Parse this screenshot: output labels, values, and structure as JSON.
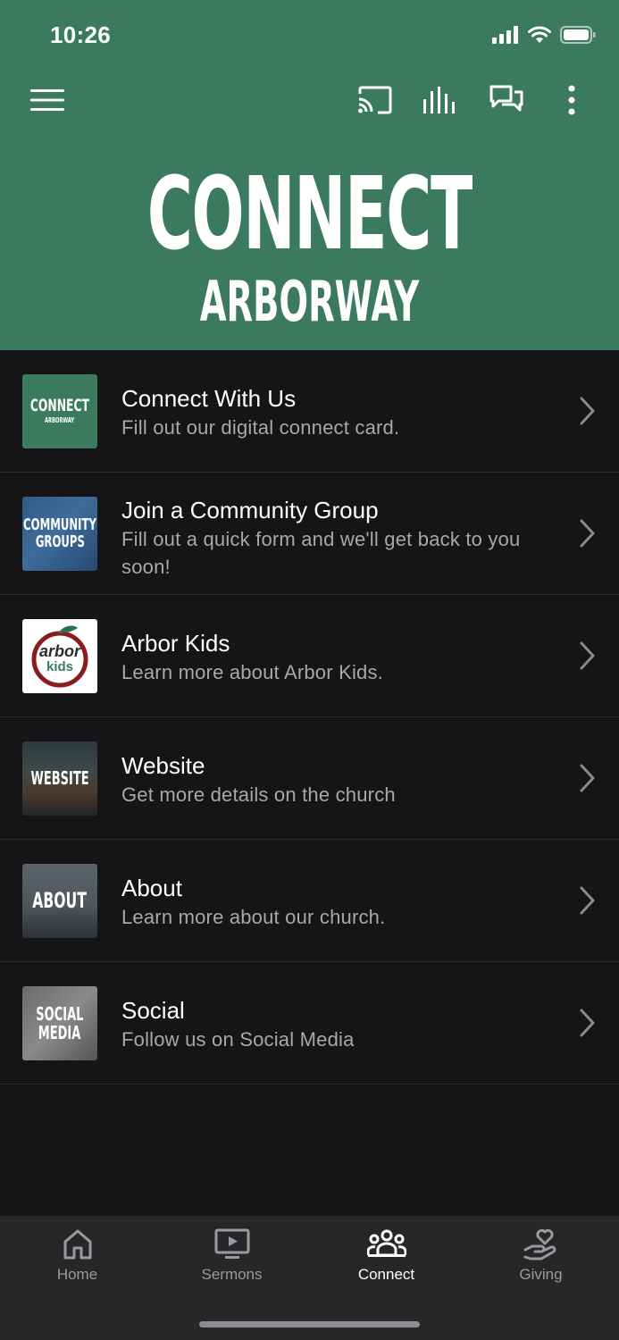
{
  "status": {
    "time": "10:26"
  },
  "hero": {
    "title": "CONNECT",
    "subtitle": "ARBORWAY"
  },
  "items": [
    {
      "thumb_line1": "CONNECT",
      "thumb_line2": "ARBORWAY",
      "title": "Connect With Us",
      "subtitle": "Fill out our digital connect card."
    },
    {
      "thumb_line1": "COMMUNITY",
      "thumb_line2": "GROUPS",
      "title": "Join a Community Group",
      "subtitle": "Fill out a quick form and we'll get back to you soon!"
    },
    {
      "thumb_line1": "arbor",
      "thumb_line2": "kids",
      "title": "Arbor Kids",
      "subtitle": "Learn more about Arbor Kids."
    },
    {
      "thumb_line1": "WEBSITE",
      "thumb_line2": "",
      "title": "Website",
      "subtitle": "Get more details on the church"
    },
    {
      "thumb_line1": "ABOUT",
      "thumb_line2": "",
      "title": "About",
      "subtitle": "Learn more about our church."
    },
    {
      "thumb_line1": "SOCIAL",
      "thumb_line2": "MEDIA",
      "title": "Social",
      "subtitle": "Follow us on Social Media"
    }
  ],
  "tabs": [
    {
      "label": "Home",
      "icon": "home-icon",
      "active": false
    },
    {
      "label": "Sermons",
      "icon": "play-screen-icon",
      "active": false
    },
    {
      "label": "Connect",
      "icon": "people-icon",
      "active": true
    },
    {
      "label": "Giving",
      "icon": "heart-hand-icon",
      "active": false
    }
  ],
  "colors": {
    "brand_green": "#3b7a5f",
    "background": "#151517",
    "tabbar": "#272729"
  }
}
